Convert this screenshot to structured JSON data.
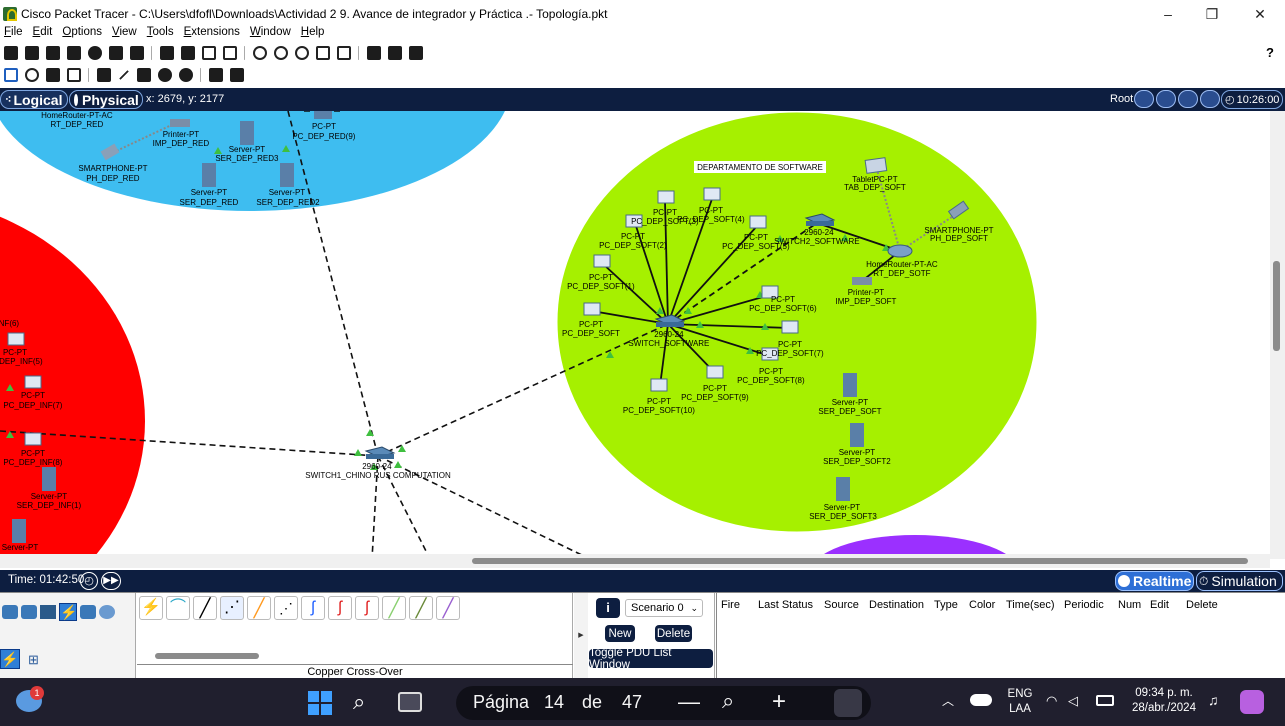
{
  "window": {
    "title": "Cisco Packet Tracer - C:\\Users\\dfofl\\Downloads\\Actividad 2 9. Avance de integrador y Práctica .- Topología.pkt",
    "controls": [
      "–",
      "❐",
      "✕"
    ]
  },
  "menu": [
    "File",
    "Edit",
    "Options",
    "View",
    "Tools",
    "Extensions",
    "Window",
    "Help"
  ],
  "help_glyph": "?",
  "workspace": {
    "logical_label": "Logical",
    "physical_label": "Physical",
    "coords": "x: 2679, y: 2177",
    "root_label": "Root",
    "clock": "10:26:00"
  },
  "canvas": {
    "software_title": "DEPARTAMENTO DE SOFTWARE",
    "top_zone": [
      "HomeRouter-PT-AC",
      "RT_DEP_RED",
      "Printer-PT",
      "IMP_DEP_RED",
      "Server-PT",
      "SER_DEP_RED3",
      "PC-PT",
      "PC_DEP_RED(9)",
      "SMARTPHONE-PT",
      "PH_DEP_RED",
      "Server-PT",
      "SER_DEP_RED",
      "Server-PT",
      "SER_DEP_RED2"
    ],
    "left_zone": [
      "NF(6)",
      "PC-PT",
      "DEP_INF(5)",
      "PC-PT",
      "PC_DEP_INF(7)",
      "PC-PT",
      "PC_DEP_INF(8)",
      "Server-PT",
      "SER_DEP_INF(1)",
      "Server-PT"
    ],
    "core_switch": [
      "2960-24",
      "SWITCH1_CHINO RUS COMPUTATION"
    ],
    "software_zone": {
      "switch_main": [
        "2960-24",
        "SWITCH_SOFTWARE"
      ],
      "switch2": [
        "2960-24",
        "SWITCH2_SOFTWARE"
      ],
      "router": [
        "HomeRouter-PT-AC",
        "RT_DEP_SOTF"
      ],
      "tablet": [
        "TabletPC-PT",
        "TAB_DEP_SOFT"
      ],
      "phone": [
        "SMARTPHONE-PT",
        "PH_DEP_SOFT"
      ],
      "printer": [
        "Printer-PT",
        "IMP_DEP_SOFT"
      ],
      "pcs": [
        [
          "PC-PT",
          "PC_DEP_SOFT(3)"
        ],
        [
          "PC-PT",
          "PC_DEP_SOFT(4)"
        ],
        [
          "PC-PT",
          "PC_DEP_SOFT(2)"
        ],
        [
          "PC-PT",
          "PC_DEP_SOFT(5)"
        ],
        [
          "PC-PT",
          "PC_DEP_SOFT(1)"
        ],
        [
          "PC-PT",
          "PC_DEP_SOFT"
        ],
        [
          "PC-PT",
          "PC_DEP_SOFT(6)"
        ],
        [
          "PC-PT",
          "PC_DEP_SOFT(7)"
        ],
        [
          "PC-PT",
          "PC_DEP_SOFT(8)"
        ],
        [
          "PC-PT",
          "PC_DEP_SOFT(9)"
        ],
        [
          "PC-PT",
          "PC_DEP_SOFT(10)"
        ]
      ],
      "servers": [
        [
          "Server-PT",
          "SER_DEP_SOFT"
        ],
        [
          "Server-PT",
          "SER_DEP_SOFT2"
        ],
        [
          "Server-PT",
          "SER_DEP_SOFT3"
        ]
      ]
    }
  },
  "timebar": {
    "time": "Time: 01:42:50",
    "realtime_label": "Realtime",
    "simulation_label": "Simulation"
  },
  "bottom": {
    "connection_name": "Copper Cross-Over",
    "scenario": "Scenario 0",
    "new_label": "New",
    "delete_label": "Delete",
    "toggle_label": "Toggle PDU List Window",
    "pdu_columns": [
      "Fire",
      "Last Status",
      "Source",
      "Destination",
      "Type",
      "Color",
      "Time(sec)",
      "Periodic",
      "Num",
      "Edit",
      "Delete"
    ]
  },
  "taskbar": {
    "notif_count": "1",
    "page_word": "Página",
    "page_num": "14",
    "de_word": "de",
    "page_total": "47",
    "lang1": "ENG",
    "lang2": "LAA",
    "time": "09:34 p. m.",
    "date": "28/abr./2024"
  },
  "colors": {
    "navy": "#0d1e40",
    "blue_zone": "#3ebdf0",
    "red_zone": "#ff0000",
    "green_zone": "#a6f000",
    "purple_zone": "#9b30ff"
  }
}
